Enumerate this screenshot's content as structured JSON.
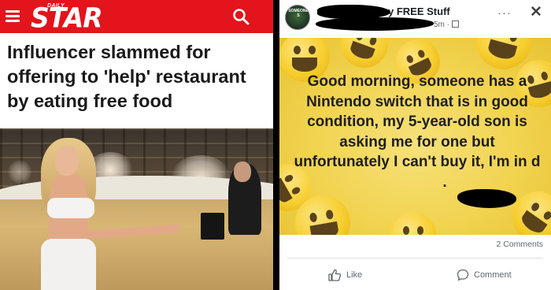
{
  "article": {
    "brand_small": "DAILY",
    "brand_big": "STAR",
    "headline": "Influencer slammed for offering to 'help' restaurant by eating free food",
    "brand_color": "#e3141b",
    "icons": [
      "hamburger-menu-icon",
      "search-icon"
    ]
  },
  "post": {
    "avatar_text": "SOMEONE S",
    "group_name": "y FREE Stuff",
    "time_text": "5m ·",
    "body": "Good morning, someone has a Nintendo switch that is in good condition, my 5-year-old son is asking me for one but unfortunately I can't buy it, I'm in d",
    "body_end": ".",
    "comments_count": "2 Comments",
    "like_label": "Like",
    "comment_label": "Comment",
    "more_label": "···",
    "close_label": "✕",
    "background_color": "#f1d34f",
    "icons": [
      "more-options-icon",
      "close-icon",
      "globe-icon",
      "like-icon",
      "comment-icon"
    ]
  }
}
